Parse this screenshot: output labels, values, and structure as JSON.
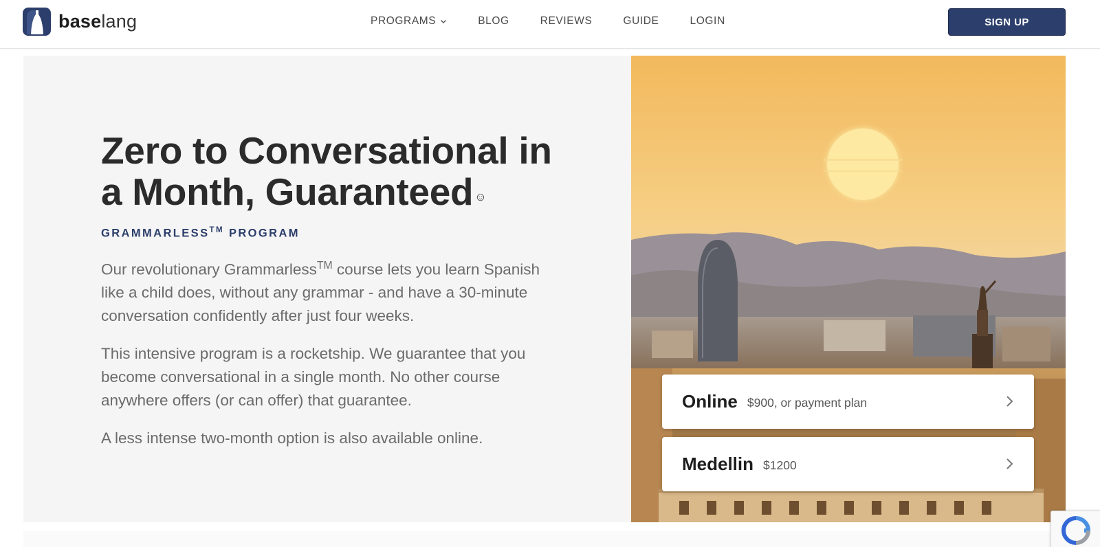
{
  "brand": {
    "name_bold": "base",
    "name_light": "lang",
    "color": "#2c3e6b"
  },
  "nav": {
    "items": [
      {
        "label": "PROGRAMS",
        "has_dropdown": true
      },
      {
        "label": "BLOG"
      },
      {
        "label": "REVIEWS"
      },
      {
        "label": "GUIDE"
      },
      {
        "label": "LOGIN"
      }
    ],
    "signup_label": "SIGN UP"
  },
  "hero": {
    "title": "Zero to Conversational in a Month, Guaranteed",
    "title_emoji": "☺",
    "eyebrow_prefix": "GRAMMARLESS",
    "eyebrow_tm": "TM",
    "eyebrow_suffix": " PROGRAM",
    "para1_prefix": "Our revolutionary Grammarless",
    "para1_tm": "TM",
    "para1_suffix": " course lets you learn Spanish like a child does, without any grammar - and have a 30-minute conversation confidently after just four weeks.",
    "para2": "This intensive program is a rocketship. We guarantee that you become conversational in a single month. No other course anywhere offers (or can offer) that guarantee.",
    "para3": "A less intense two-month option is also available online.",
    "image_alt": "Barcelona skyline at sunset"
  },
  "options": [
    {
      "name": "Online",
      "price": "$900, or payment plan",
      "icon": "chevron-right-icon"
    },
    {
      "name": "Medellin",
      "price": "$1200",
      "icon": "chevron-right-icon"
    }
  ]
}
